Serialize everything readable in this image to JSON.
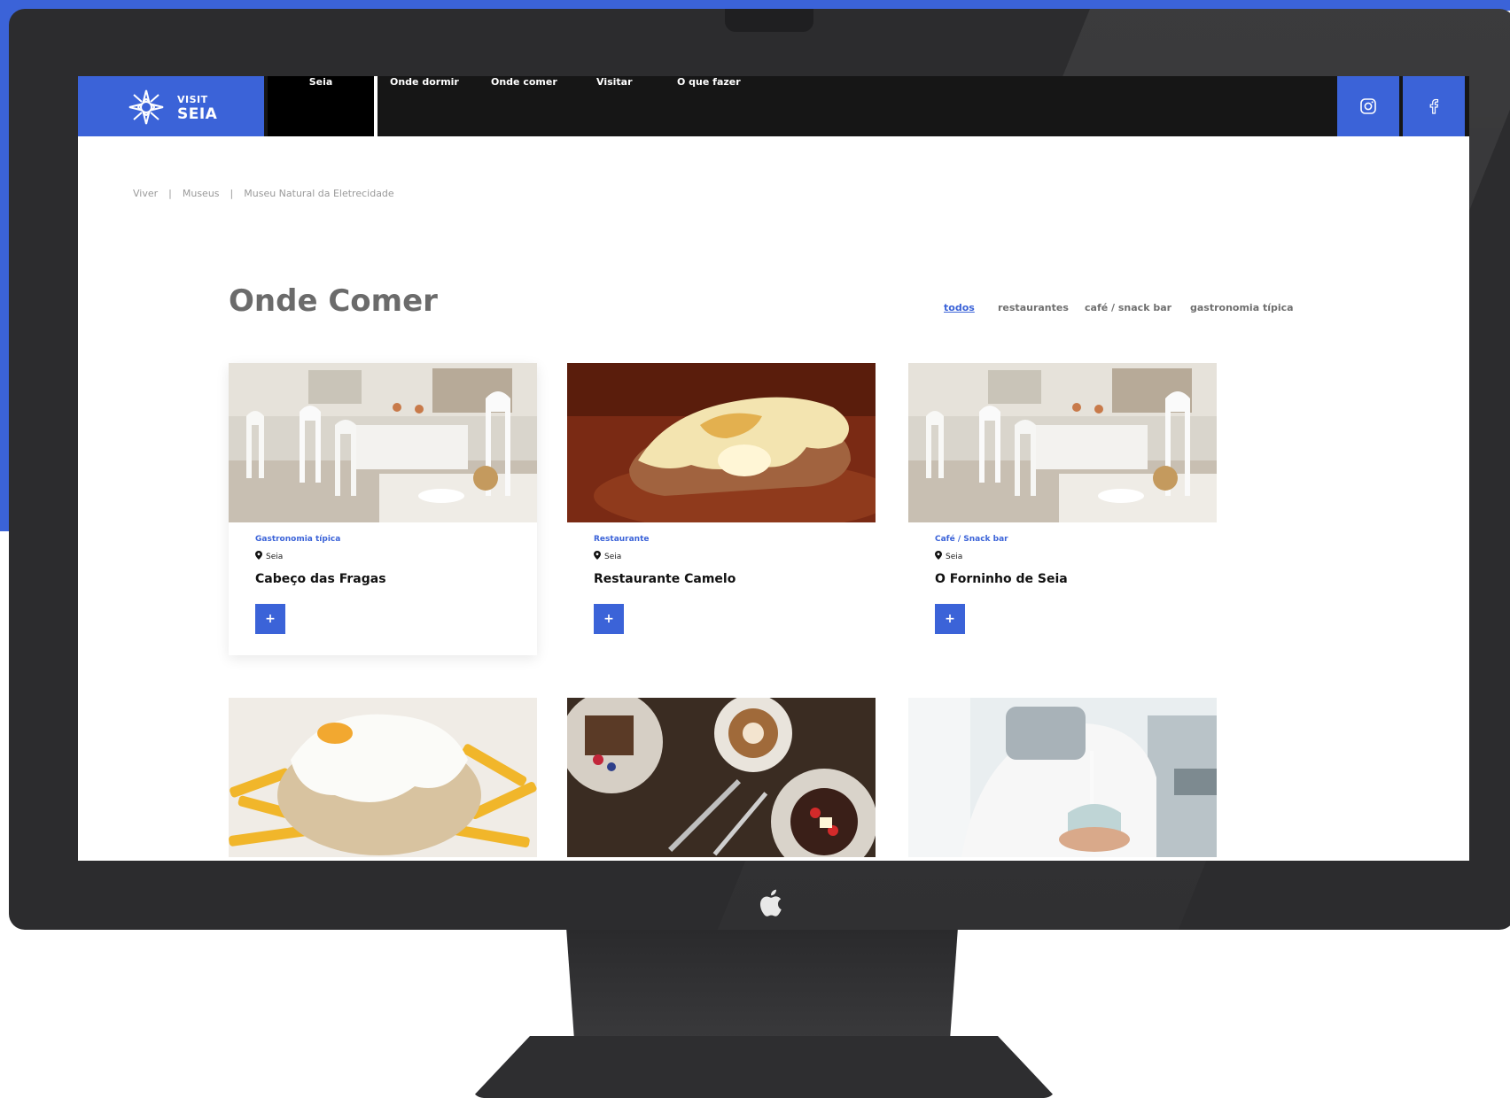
{
  "brand": {
    "small": "VISIT",
    "big": "SEIA",
    "accent": "#3b63d8",
    "logo_icon": "star-flower-icon"
  },
  "nav": {
    "items": [
      {
        "label": "Seia"
      },
      {
        "label": "Onde dormir"
      },
      {
        "label": "Onde comer"
      },
      {
        "label": "Visitar"
      },
      {
        "label": "O que fazer"
      }
    ],
    "social": [
      {
        "icon": "instagram-icon"
      },
      {
        "icon": "facebook-icon"
      }
    ]
  },
  "breadcrumb": {
    "items": [
      "Viver",
      "Museus",
      "Museu Natural da Eletrecidade"
    ],
    "separator": "|"
  },
  "section": {
    "title": "Onde Comer",
    "filters": [
      "todos",
      "restaurantes",
      "café / snack bar",
      "gastronomia típica"
    ],
    "active_filter": "todos"
  },
  "cards": [
    {
      "category": "Gastronomia típica",
      "location": "Seia",
      "name": "Cabeço das Fragas",
      "button": "+"
    },
    {
      "category": "Restaurante",
      "location": "Seia",
      "name": "Restaurante Camelo",
      "button": "+"
    },
    {
      "category": "Café / Snack bar",
      "location": "Seia",
      "name": "O Forninho de Seia",
      "button": "+"
    }
  ]
}
